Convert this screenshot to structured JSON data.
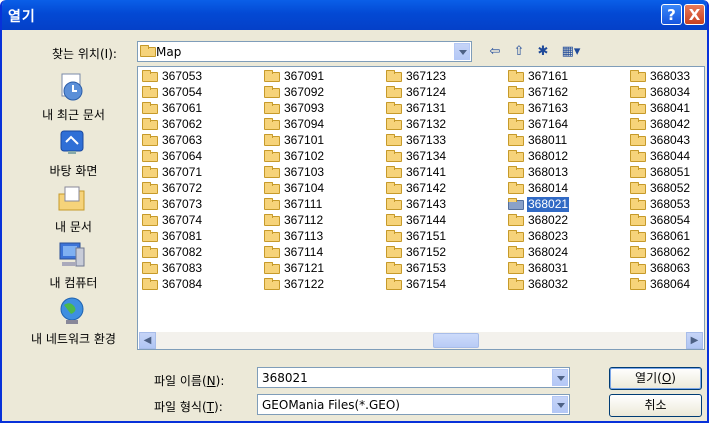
{
  "window": {
    "title": "열기",
    "help_glyph": "?",
    "close_glyph": "X"
  },
  "lookin": {
    "label": "찾는 위치(I):",
    "value": "Map"
  },
  "toolbar": {
    "back_icon": "back-arrow-icon",
    "up_icon": "up-folder-icon",
    "newfolder_icon": "new-folder-icon",
    "views_icon": "views-menu-icon"
  },
  "places": [
    {
      "label": "내 최근 문서",
      "icon": "recent-documents-icon"
    },
    {
      "label": "바탕 화면",
      "icon": "desktop-icon"
    },
    {
      "label": "내 문서",
      "icon": "my-documents-icon"
    },
    {
      "label": "내 컴퓨터",
      "icon": "my-computer-icon"
    },
    {
      "label": "내 네트워크 환경",
      "icon": "my-network-icon"
    }
  ],
  "files": [
    [
      "367053",
      "367054",
      "367061",
      "367062",
      "367063",
      "367064",
      "367071",
      "367072",
      "367073",
      "367074",
      "367081",
      "367082",
      "367083",
      "367084"
    ],
    [
      "367091",
      "367092",
      "367093",
      "367094",
      "367101",
      "367102",
      "367103",
      "367104",
      "367111",
      "367112",
      "367113",
      "367114",
      "367121",
      "367122"
    ],
    [
      "367123",
      "367124",
      "367131",
      "367132",
      "367133",
      "367134",
      "367141",
      "367142",
      "367143",
      "367144",
      "367151",
      "367152",
      "367153",
      "367154"
    ],
    [
      "367161",
      "367162",
      "367163",
      "367164",
      "368011",
      "368012",
      "368013",
      "368014",
      "368021",
      "368022",
      "368023",
      "368024",
      "368031",
      "368032"
    ],
    [
      "368033",
      "368034",
      "368041",
      "368042",
      "368043",
      "368044",
      "368051",
      "368052",
      "368053",
      "368054",
      "368061",
      "368062",
      "368063",
      "368064"
    ]
  ],
  "selected_file": "368021",
  "filename": {
    "label": "파일 이름(N):",
    "value": "368021"
  },
  "filetype": {
    "label": "파일 형식(T):",
    "value": "GEOMania Files(*.GEO)"
  },
  "buttons": {
    "open": "열기(O)",
    "cancel": "취소"
  }
}
